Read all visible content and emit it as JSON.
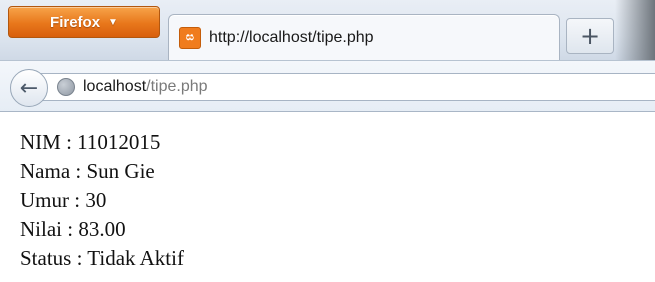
{
  "browser": {
    "menu_button": "Firefox",
    "menu_caret": "▼",
    "tab_title": "http://localhost/tipe.php",
    "new_tab": "+",
    "back": "←",
    "url_host": "localhost",
    "url_path": "/tipe.php"
  },
  "page": {
    "lines": [
      "NIM : 11012015",
      "Nama : Sun Gie",
      "Umur : 30",
      "Nilai : 83.00",
      "Status : Tidak Aktif"
    ]
  },
  "icons": {
    "tab_favicon": "xampp-favicon",
    "site_identity": "globe-icon",
    "back": "back-arrow-icon"
  }
}
